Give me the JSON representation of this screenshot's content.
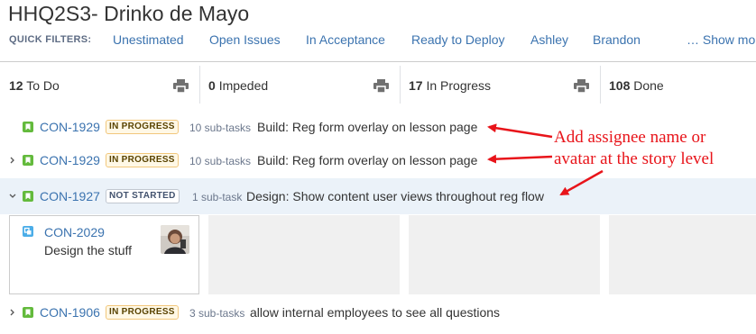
{
  "board": {
    "title": "HHQ2S3- Drinko de Mayo"
  },
  "quick_filters": {
    "label": "QUICK FILTERS:",
    "items": [
      "Unestimated",
      "Open Issues",
      "In Acceptance",
      "Ready to Deploy",
      "Ashley",
      "Brandon"
    ],
    "more": "… Show mo"
  },
  "columns": [
    {
      "count": "12",
      "name": "To Do"
    },
    {
      "count": "0",
      "name": "Impeded"
    },
    {
      "count": "17",
      "name": "In Progress"
    },
    {
      "count": "108",
      "name": "Done"
    }
  ],
  "swimlanes": [
    {
      "key": "CON-1929",
      "status": "IN PROGRESS",
      "subtasks": "10 sub-tasks",
      "summary": "Build: Reg form overlay on lesson page"
    },
    {
      "key": "CON-1929",
      "status": "IN PROGRESS",
      "subtasks": "10 sub-tasks",
      "summary": "Build: Reg form overlay on lesson page"
    },
    {
      "key": "CON-1927",
      "status": "NOT STARTED",
      "subtasks": "1 sub-task",
      "summary": "Design: Show content user views throughout reg flow"
    },
    {
      "key": "CON-1906",
      "status": "IN PROGRESS",
      "subtasks": "3 sub-tasks",
      "summary": "allow internal employees to see all questions"
    }
  ],
  "card": {
    "key": "CON-2029",
    "summary": "Design the stuff"
  },
  "annotation": {
    "line1": "Add assignee name or",
    "line2": "avatar at the story level"
  },
  "colors": {
    "link": "#3b73af",
    "story_icon": "#63ba3c",
    "subtask_icon": "#4bade8",
    "annotation": "#e8141a",
    "selected_lane": "#ebf2f9"
  },
  "icons": [
    "print-icon",
    "story-icon",
    "subtask-icon",
    "chevron-right-icon",
    "chevron-down-icon",
    "avatar"
  ]
}
